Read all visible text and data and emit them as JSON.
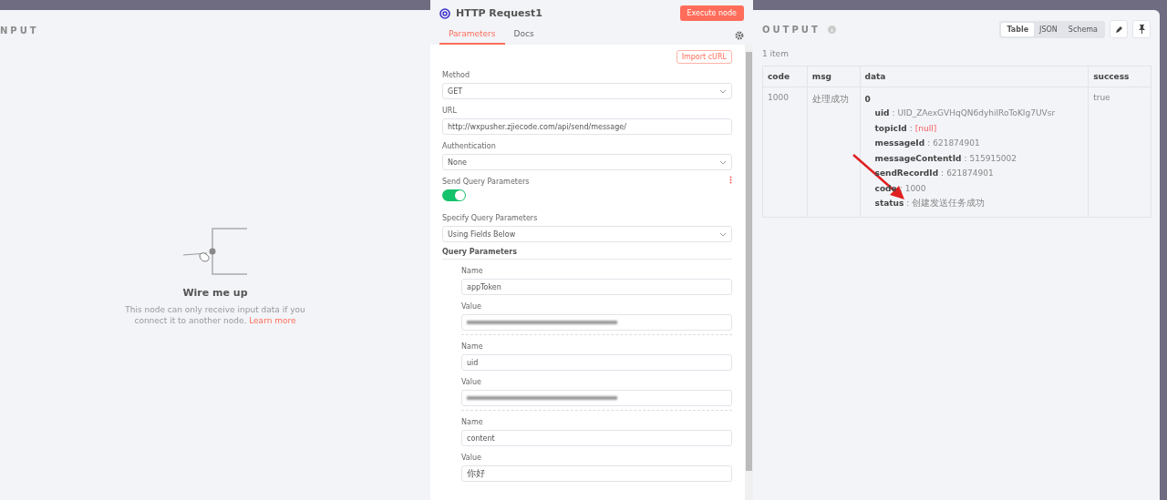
{
  "input_panel": {
    "title": "NPUT",
    "empty_state": {
      "title": "Wire me up",
      "text": "This node can only receive input data if you connect it to another node.",
      "link": "Learn more"
    }
  },
  "node_panel": {
    "title": "HTTP Request1",
    "execute_button": "Execute node",
    "tabs": [
      {
        "label": "Parameters",
        "selected": true
      },
      {
        "label": "Docs",
        "selected": false
      }
    ],
    "import_button": "Import cURL",
    "method": {
      "label": "Method",
      "value": "GET"
    },
    "url": {
      "label": "URL",
      "value": "http://wxpusher.zjiecode.com/api/send/message/"
    },
    "authentication": {
      "label": "Authentication",
      "value": "None"
    },
    "send_query": {
      "label": "Send Query Parameters",
      "on": true
    },
    "specify_query": {
      "label": "Specify Query Parameters",
      "value": "Using Fields Below"
    },
    "query_parameters": {
      "title": "Query Parameters",
      "items": [
        {
          "name_label": "Name",
          "name": "appToken",
          "value_label": "Value",
          "blurred": true
        },
        {
          "name_label": "Name",
          "name": "uid",
          "value_label": "Value",
          "blurred": true
        },
        {
          "name_label": "Name",
          "name": "content",
          "value_label": "Value",
          "value": "你好",
          "blurred": false
        }
      ]
    }
  },
  "output_panel": {
    "title": "OUTPUT",
    "view_tabs": [
      {
        "label": "Table",
        "selected": true
      },
      {
        "label": "JSON",
        "selected": false
      },
      {
        "label": "Schema",
        "selected": false
      }
    ],
    "count": "1 item",
    "table": {
      "columns": [
        "code",
        "msg",
        "data",
        "success"
      ],
      "separator": ":",
      "rows": [
        {
          "code": "1000",
          "msg": "处理成功",
          "data_index": "0",
          "data": [
            {
              "key": "uid",
              "value": "UID_ZAexGVHqQN6dyhiIRoToKIg7UVsr",
              "null": false
            },
            {
              "key": "topicId",
              "value": "[null]",
              "null": true
            },
            {
              "key": "messageId",
              "value": "621874901",
              "null": false
            },
            {
              "key": "messageContentId",
              "value": "515915002",
              "null": false
            },
            {
              "key": "sendRecordId",
              "value": "621874901",
              "null": false
            },
            {
              "key": "code",
              "value": "1000",
              "null": false
            },
            {
              "key": "status",
              "value": "创建发送任务成功",
              "null": false
            }
          ],
          "success": "true"
        }
      ]
    }
  },
  "annotations": [
    {
      "kind": "arrow"
    }
  ]
}
